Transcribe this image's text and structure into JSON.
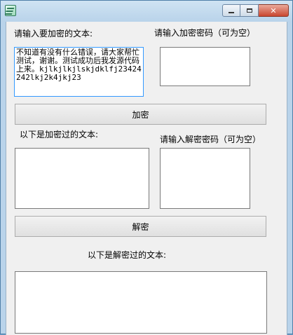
{
  "window": {
    "title": "",
    "controls": {
      "minimize": "minimize",
      "maximize": "maximize",
      "close": "✕"
    }
  },
  "encrypt": {
    "input_label": "请输入要加密的文本:",
    "input_value": "不知道有没有什么错误，请大家帮忙测试，谢谢。测试成功后我发源代码上来。kjlkjlkjlskjdklfj23424242lkj2k4jkj23",
    "password_label": "请输入加密密码（可为空）",
    "password_value": "",
    "button_label": "加密"
  },
  "decrypt": {
    "encrypted_label": "以下是加密过的文本:",
    "encrypted_value": "",
    "password_label": "请输入解密密码（可为空）",
    "password_value": "",
    "button_label": "解密",
    "output_label": "以下是解密过的文本:",
    "output_value": ""
  }
}
